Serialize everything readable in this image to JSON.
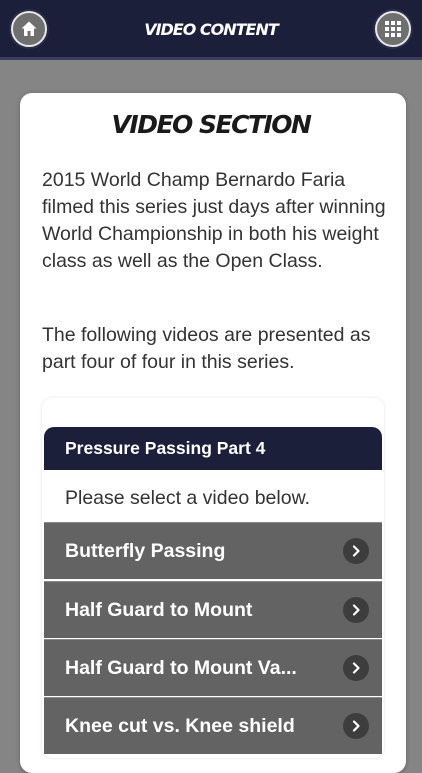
{
  "header": {
    "title": "VIDEO CONTENT",
    "home_icon": "home-icon",
    "grid_icon": "grid-menu-icon"
  },
  "section": {
    "title": "VIDEO SECTION",
    "description_1": "2015 World Champ Bernardo Faria filmed this series just days after winning World Championship in both his weight class as well as the Open Class.",
    "description_2": "The following videos are presented as part four of four in this series."
  },
  "video_list": {
    "header": "Pressure Passing Part 4",
    "prompt": "Please select a video below.",
    "items": [
      {
        "label": "Butterfly Passing"
      },
      {
        "label": "Half Guard to Mount"
      },
      {
        "label": "Half Guard to Mount Va..."
      },
      {
        "label": "Knee cut vs. Knee shield"
      }
    ],
    "item_icon": "chevron-right-icon"
  },
  "colors": {
    "header_bg": "#1b1f3a",
    "page_bg": "#858585",
    "item_bg": "#636363",
    "card_bg": "#ffffff"
  }
}
